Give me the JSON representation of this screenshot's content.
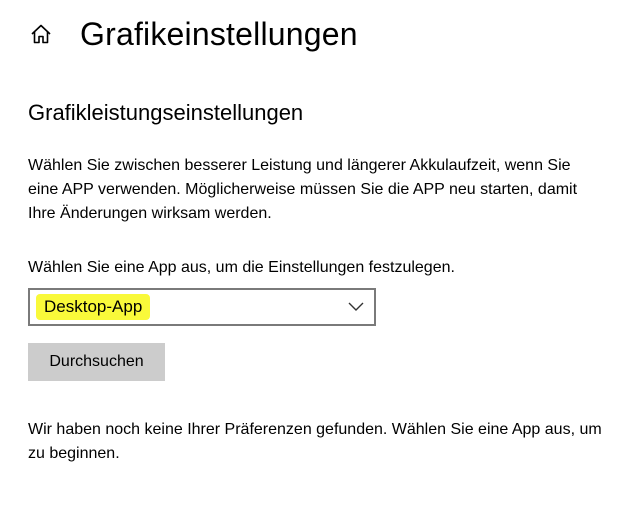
{
  "header": {
    "home_icon": "home-icon",
    "title": "Grafikeinstellungen"
  },
  "section": {
    "title": "Grafikleistungseinstellungen",
    "description": "Wählen Sie zwischen besserer Leistung und längerer Akkulaufzeit, wenn Sie eine APP verwenden. Möglicherweise müssen Sie die APP neu starten, damit Ihre Änderungen wirksam werden."
  },
  "app_select": {
    "label": "Wählen Sie eine App aus, um die Einstellungen festzulegen.",
    "selected_value": "Desktop-App",
    "chevron_icon": "chevron-down-icon",
    "highlight_color": "#f9f93a"
  },
  "browse": {
    "label": "Durchsuchen"
  },
  "empty_state": {
    "message": "Wir haben noch keine Ihrer Präferenzen gefunden. Wählen Sie eine App aus, um zu beginnen."
  }
}
